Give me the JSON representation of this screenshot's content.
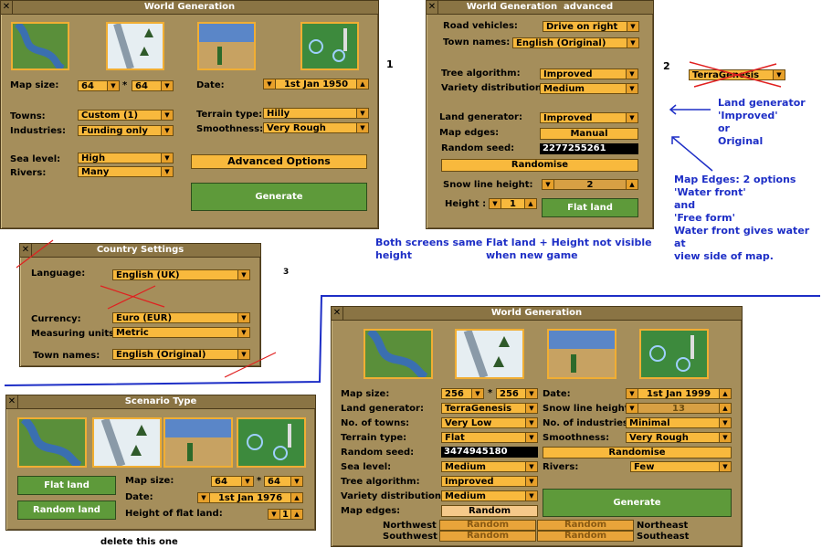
{
  "markers": {
    "one": "1",
    "two": "2",
    "three": "3"
  },
  "win1": {
    "title": "World Generation",
    "map_size_label": "Map size:",
    "map_w": "64",
    "map_times": "*",
    "map_h": "64",
    "date_label": "Date:",
    "date": "1st Jan 1950",
    "towns_label": "Towns:",
    "towns": "Custom (1)",
    "industries_label": "Industries:",
    "industries": "Funding only",
    "terrain_label": "Terrain type:",
    "terrain": "Hilly",
    "smooth_label": "Smoothness:",
    "smooth": "Very Rough",
    "sea_label": "Sea level:",
    "sea": "High",
    "rivers_label": "Rivers:",
    "rivers": "Many",
    "advanced": "Advanced Options",
    "generate": "Generate"
  },
  "win2": {
    "title": "World Generation",
    "title_suffix": "advanced",
    "road_label": "Road vehicles:",
    "road": "Drive on right",
    "townnames_label": "Town names:",
    "townnames": "English (Original)",
    "tree_label": "Tree algorithm:",
    "tree": "Improved",
    "variety_label": "Variety distribution:",
    "variety": "Medium",
    "landgen_label": "Land generator:",
    "landgen": "Improved",
    "edges_label": "Map edges:",
    "edges": "Manual",
    "seed_label": "Random seed:",
    "seed": "2277255261",
    "randomise": "Randomise",
    "snow_label": "Snow line height:",
    "snow": "2",
    "height_label": "Height :",
    "height": "1",
    "flat": "Flat land"
  },
  "terragenesis": "TerraGenesis",
  "notes": {
    "landgen": "Land generator\n'Improved'\nor\nOriginal",
    "edges": "Map Edges: 2 options\n'Water front'\nand\n'Free form'\nWater front gives water at\nview side of map.",
    "same_height": "Both screens same\nheight",
    "flat_height": "Flat land + Height not visible\nwhen new game",
    "delete": "delete this one"
  },
  "country": {
    "title": "Country Settings",
    "language_label": "Language:",
    "language": "English (UK)",
    "currency_label": "Currency:",
    "currency": "Euro (EUR)",
    "units_label": "Measuring units:",
    "units": "Metric",
    "townnames_label": "Town names:",
    "townnames": "English (Original)"
  },
  "scenario": {
    "title": "Scenario Type",
    "flat": "Flat land",
    "random": "Random land",
    "map_size_label": "Map size:",
    "map_w": "64",
    "map_times": "*",
    "map_h": "64",
    "date_label": "Date:",
    "date": "1st Jan 1976",
    "height_label": "Height of flat land:",
    "height": "1"
  },
  "win3": {
    "title": "World Generation",
    "map_size_label": "Map size:",
    "map_w": "256",
    "map_times": "*",
    "map_h": "256",
    "date_label": "Date:",
    "date": "1st Jan 1999",
    "landgen_label": "Land generator:",
    "landgen": "TerraGenesis",
    "snow_label": "Snow line height:",
    "snow": "13",
    "towns_label": "No. of towns:",
    "towns": "Very Low",
    "industries_label": "No. of industries:",
    "industries": "Minimal",
    "terrain_label": "Terrain type:",
    "terrain": "Flat",
    "smooth_label": "Smoothness:",
    "smooth": "Very Rough",
    "seed_label": "Random seed:",
    "seed": "3474945180",
    "randomise": "Randomise",
    "sea_label": "Sea level:",
    "sea": "Medium",
    "rivers_label": "Rivers:",
    "rivers": "Few",
    "tree_label": "Tree algorithm:",
    "tree": "Improved",
    "variety_label": "Variety distribution:",
    "variety": "Medium",
    "edges_label": "Map edges:",
    "edges": "Random",
    "generate": "Generate",
    "nw": "Northwest",
    "sw": "Southwest",
    "ne": "Northeast",
    "se": "Southeast",
    "rand": "Random"
  },
  "colors": {
    "orange": "#f8b93d",
    "green": "#5e9a3a",
    "window": "#a58e5b",
    "note_blue": "#1d2ec6",
    "red": "#e02020"
  }
}
